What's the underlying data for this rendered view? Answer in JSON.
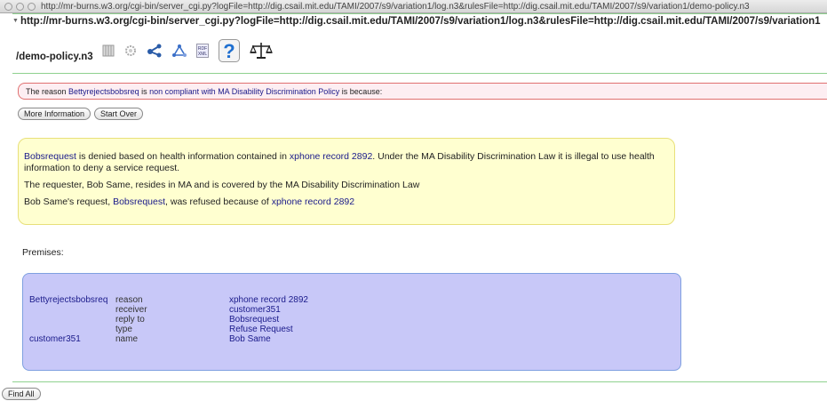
{
  "window": {
    "title": "http://mr-burns.w3.org/cgi-bin/server_cgi.py?logFile=http://dig.csail.mit.edu/TAMI/2007/s9/variation1/log.n3&rulesFile=http://dig.csail.mit.edu/TAMI/2007/s9/variation1/demo-policy.n3"
  },
  "header": {
    "url_line1": "http://mr-burns.w3.org/cgi-bin/server_cgi.py?logFile=http://dig.csail.mit.edu/TAMI/2007/s9/variation1/log.n3&rulesFile=http://dig.csail.mit.edu/TAMI/2007/s9/variation1",
    "url_line2": "/demo-policy.n3"
  },
  "toolbar": {
    "icons": [
      "table-view",
      "settings-gear",
      "share-graph",
      "graph-view",
      "rdf-xml",
      "help-question",
      "justice-scales"
    ],
    "rdf_label_top": "RDF",
    "rdf_label_bottom": "XML",
    "help_glyph": "?"
  },
  "reason": {
    "prefix": "The reason",
    "subject": "Bettyrejectsbobsreq",
    "is": "is",
    "status": "non compliant with",
    "policy": "MA Disability Discrimination Policy",
    "suffix": "is because:"
  },
  "buttons": {
    "more_info": "More Information",
    "start_over": "Start Over",
    "find_all": "Find All"
  },
  "explanation": {
    "p1_link1": "Bobsrequest",
    "p1_text1": " is denied based on health information contained in ",
    "p1_link2": "xphone record 2892",
    "p1_text2": ". Under the MA Disability Discrimination Law it is illegal to use health information to deny a service request.",
    "p2": "The requester, Bob Same, resides in MA and is covered by the MA Disability Discrimination Law",
    "p3_text1": "Bob Same's request, ",
    "p3_link1": "Bobsrequest",
    "p3_text2": ", was refused because of ",
    "p3_link2": "xphone record 2892"
  },
  "premises": {
    "label": "Premises:",
    "rows": [
      {
        "subject": "Bettyrejectsbobsreq",
        "property": "reason",
        "value": "xphone record 2892"
      },
      {
        "subject": "",
        "property": "receiver",
        "value": "customer351"
      },
      {
        "subject": "",
        "property": "reply to",
        "value": "Bobsrequest"
      },
      {
        "subject": "",
        "property": "type",
        "value": "Refuse Request"
      },
      {
        "subject": "customer351",
        "property": "name",
        "value": "Bob Same"
      }
    ]
  },
  "colors": {
    "link": "#1a1a8a",
    "reason_border": "#e07070",
    "reason_bg": "#fdeef2",
    "explanation_bg": "#ffffd0",
    "premises_bg": "#c8c8f8",
    "rule_green": "#8fd18f"
  }
}
